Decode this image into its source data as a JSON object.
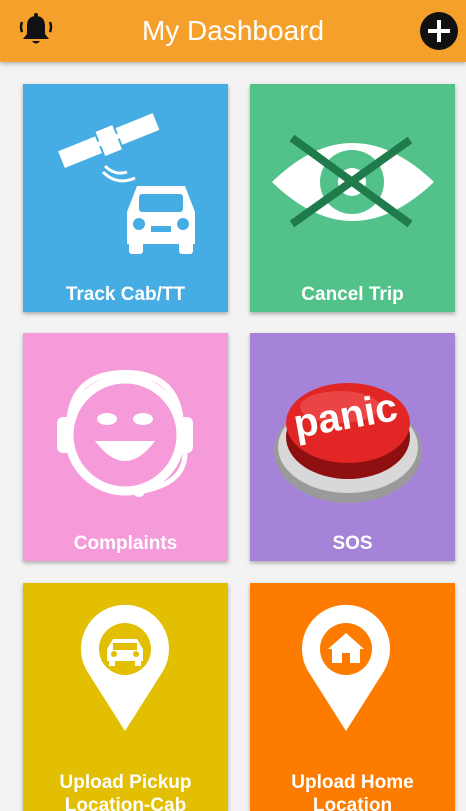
{
  "header": {
    "title": "My Dashboard",
    "bell_icon": "bell-icon",
    "add_icon": "plus-icon",
    "color": "#f6a02c"
  },
  "tiles": [
    {
      "label": "Track Cab/TT",
      "color": "#45ade3",
      "icon": "satellite-car-icon"
    },
    {
      "label": "Cancel Trip",
      "color": "#52c28a",
      "icon": "crossed-eye-icon"
    },
    {
      "label": "Complaints",
      "color": "#f59bd9",
      "icon": "support-headset-icon"
    },
    {
      "label": "SOS",
      "color": "#a483d8",
      "icon": "panic-button-icon",
      "icon_text": "panic"
    },
    {
      "label": "Upload Pickup Location-Cab",
      "label_line1": "Upload Pickup",
      "label_line2": "Location-Cab",
      "color": "#e2bf02",
      "icon": "car-location-pin-icon"
    },
    {
      "label": "Upload Home Location",
      "label_line1": "Upload Home",
      "label_line2": "Location",
      "color": "#fd7c00",
      "icon": "home-location-pin-icon"
    }
  ]
}
